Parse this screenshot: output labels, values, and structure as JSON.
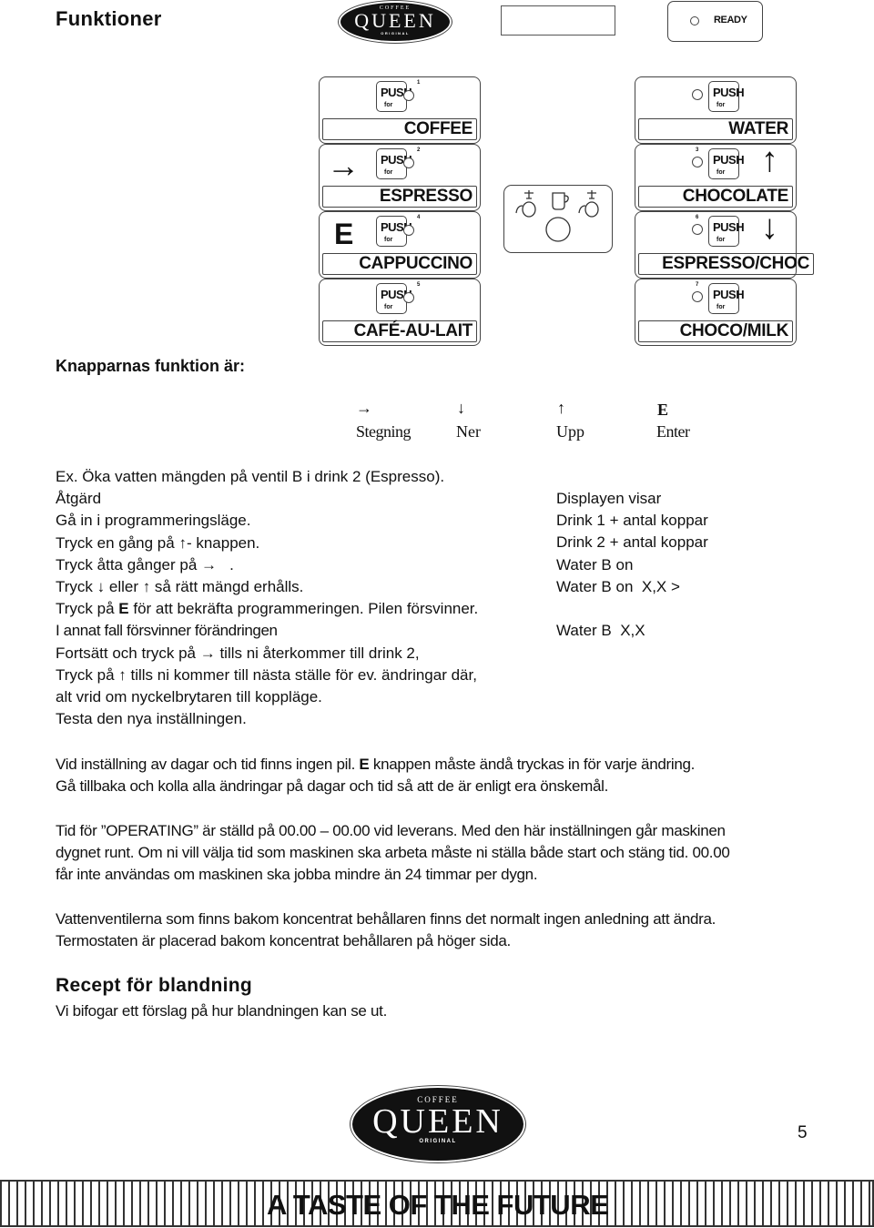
{
  "header": {
    "title": "Funktioner",
    "logo": {
      "top": "COFFEE",
      "main": "QUEEN",
      "bottom": "ORIGINAL"
    },
    "display_text": "",
    "ready_label": "READY"
  },
  "panel": {
    "push_label": "PUSH",
    "for_label": "for",
    "left_buttons": [
      {
        "name": "COFFEE",
        "number": "1",
        "marker": ""
      },
      {
        "name": "ESPRESSO",
        "number": "2",
        "marker": "→"
      },
      {
        "name": "CAPPUCCINO",
        "number": "4",
        "marker": "E"
      },
      {
        "name": "CAFÉ-AU-LAIT",
        "number": "5",
        "marker": ""
      }
    ],
    "right_buttons": [
      {
        "name": "WATER",
        "number": "",
        "marker": ""
      },
      {
        "name": "CHOCOLATE",
        "number": "3",
        "marker": "↑"
      },
      {
        "name": "ESPRESSO/CHOC",
        "number": "6",
        "marker": "↓"
      },
      {
        "name": "CHOCO/MILK",
        "number": "7",
        "marker": ""
      }
    ]
  },
  "functions_heading": "Knapparnas funktion är:",
  "legend": [
    {
      "symbol": "→",
      "label": "Stegning"
    },
    {
      "symbol": "↓",
      "label": "Ner"
    },
    {
      "symbol": "↑",
      "label": "Upp"
    },
    {
      "symbol": "E",
      "label": "Enter"
    }
  ],
  "example": {
    "title": "Ex. Öka vatten mängden på ventil B i drink 2 (Espresso).",
    "action_header": "Åtgärd",
    "display_header": "Displayen visar",
    "steps": [
      {
        "action": "Gå in i programmeringsläge.",
        "display": "Drink 1 + antal koppar"
      },
      {
        "action": "Tryck en gång på ↑- knappen.",
        "display": "Drink 2 + antal koppar"
      },
      {
        "action": "Tryck åtta gånger på →   .",
        "display": "Water B on"
      },
      {
        "action": "Tryck ↓ eller ↑ så rätt mängd erhålls.",
        "display": "Water B on  X,X >"
      },
      {
        "action_pre": "Tryck på ",
        "action_bold": "E",
        "action_post": " för att bekräfta programmeringen. Pilen försvinner.",
        "display": ""
      },
      {
        "action": "I annat fall försvinner förändringen",
        "display": "Water B  X,X"
      },
      {
        "action": "Fortsätt och tryck på → tills ni återkommer till drink 2,",
        "display": ""
      },
      {
        "action": "Tryck på ↑ tills ni kommer till nästa ställe för ev. ändringar där,",
        "display": ""
      },
      {
        "action": "alt vrid om nyckelbrytaren till koppläge.",
        "display": ""
      },
      {
        "action": "Testa den nya inställningen.",
        "display": ""
      }
    ]
  },
  "paragraphs": {
    "p1_pre": "Vid inställning av dagar och tid finns ingen pil. ",
    "p1_bold": "E",
    "p1_post": " knappen måste ändå tryckas in för varje ändring.",
    "p1_line2": "Gå tillbaka och kolla alla ändringar på dagar och tid så att de är enligt era önskemål.",
    "p2_line1": "Tid för ”OPERATING” är ställd på 00.00 – 00.00 vid leverans. Med den här inställningen går maskinen",
    "p2_line2": "dygnet runt. Om ni vill välja tid som maskinen ska arbeta måste ni ställa både start och stäng tid. 00.00",
    "p2_line3": "får inte användas om maskinen ska jobba mindre än 24 timmar per dygn.",
    "p3_line1": "Vattenventilerna som finns bakom koncentrat behållaren finns det normalt ingen anledning att ändra.",
    "p3_line2": "Termostaten är placerad bakom koncentrat behållaren på höger sida."
  },
  "recipe": {
    "heading": "Recept för blandning",
    "text": "Vi bifogar ett förslag på hur blandningen kan se ut."
  },
  "footer": {
    "page_number": "5",
    "slogan": "A TASTE OF THE FUTURE"
  }
}
